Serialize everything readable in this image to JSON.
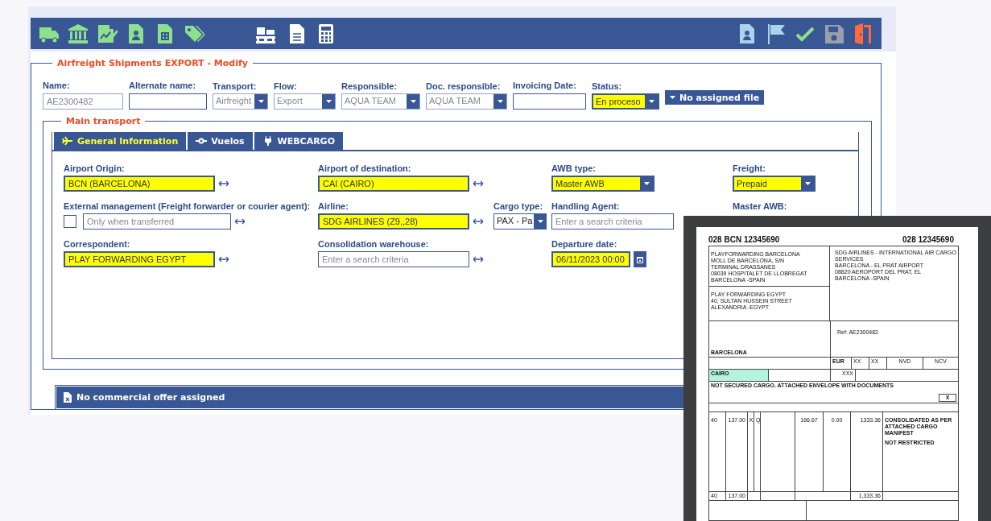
{
  "form": {
    "title": "Airfreight Shipments EXPORT - Modify",
    "header_fields": [
      {
        "kind": "input",
        "label": "Name:",
        "value": "AE2300482",
        "disabled": true,
        "required": false
      },
      {
        "kind": "input",
        "label": "Alternate name:",
        "disabled": false,
        "required": false
      },
      {
        "kind": "select",
        "label": "Transport:",
        "value": "Airfreight",
        "disabled": true,
        "required": false
      },
      {
        "kind": "select",
        "label": "Flow:",
        "value": "Export",
        "disabled": true,
        "required": false
      },
      {
        "kind": "select",
        "label": "Responsible:",
        "value": "AQUA TEAM",
        "disabled": true,
        "required": false
      },
      {
        "kind": "select",
        "label": "Doc. responsible:",
        "value": "AQUA TEAM",
        "disabled": true,
        "required": false
      },
      {
        "kind": "input",
        "label": "Invoicing Date:",
        "disabled": false,
        "required": false
      },
      {
        "kind": "select",
        "label": "Status:",
        "value": "En proceso",
        "disabled": false,
        "required": true
      },
      {
        "kind": "button",
        "text": "No assigned file"
      }
    ],
    "main_transport": {
      "title": "Main transport",
      "tabs": [
        {
          "label": "General Information",
          "selected": true
        },
        {
          "label": "Vuelos",
          "selected": false
        },
        {
          "label": "WEBCARGO",
          "selected": false
        }
      ],
      "rows": [
        {
          "cells": [
            {
              "fields": [
                {
                  "kind": "link_input",
                  "label": "Airport Origin:",
                  "value": "BCN (BARCELONA)",
                  "required": true
                }
              ]
            },
            {
              "fields": [
                {
                  "kind": "link_input",
                  "label": "Airport of destination:",
                  "value": "CAI (CAIRO)",
                  "required": true
                }
              ]
            },
            {
              "fields": [
                {
                  "kind": "select",
                  "label": "AWB type:",
                  "value": "Master AWB",
                  "required": true
                }
              ]
            },
            {
              "fields": [
                {
                  "kind": "select",
                  "label": "Freight:",
                  "value": "Prepaid",
                  "required": true
                }
              ]
            }
          ]
        },
        {
          "cells": [
            {
              "fields": [
                {
                  "kind": "check_input",
                  "label": "External management (Freight forwarder or courier agent):",
                  "placeholder": "Only when transferred",
                  "checked": false,
                  "required": false
                }
              ]
            },
            {
              "fields": [
                {
                  "kind": "link_input",
                  "label": "Airline:",
                  "value": "SDG AIRLINES (Z9,,28)",
                  "required": true
                },
                {
                  "kind": "select",
                  "label": "Cargo type:",
                  "value": "PAX - Pa",
                  "required": false
                }
              ]
            },
            {
              "fields": [
                {
                  "kind": "input",
                  "label": "Handling Agent:",
                  "placeholder": "Enter a search criteria",
                  "required": false
                }
              ]
            },
            {
              "fields": [
                {
                  "kind": "label",
                  "label": "Master AWB:"
                }
              ]
            }
          ]
        },
        {
          "cells": [
            {
              "fields": [
                {
                  "kind": "link_input",
                  "label": "Correspondent:",
                  "value": "PLAY FORWARDING EGYPT",
                  "required": true
                }
              ]
            },
            {
              "fields": [
                {
                  "kind": "link_input",
                  "label": "Consolidation warehouse:",
                  "placeholder": "Enter a search criteria",
                  "required": false
                }
              ]
            },
            {
              "fields": [
                {
                  "kind": "date",
                  "label": "Departure date:",
                  "value": "06/11/2023 00:00",
                  "required": true
                }
              ]
            }
          ]
        }
      ]
    },
    "commercial_offer": "No commercial offer assigned"
  },
  "awb_document": {
    "number_left": "028 BCN  12345690",
    "number_right": "028  12345690",
    "shipper": [
      "PLAYFORWARDING BARCELONA",
      "MOLL DE BARCELONA, S/N",
      "TERMINAL DRASSANES",
      "08039 HOSPITALET DE LLOBREGAT",
      "BARCELONA -SPAIN"
    ],
    "consignee": [
      "PLAY FORWARDING EGYPT",
      "40, SULTAN HUSSEIN STREET",
      "ALEXANDRIA -EGYPT"
    ],
    "carrier": [
      "SDG AIRLINES - INTERNATIONAL AIR CARGO",
      "SERVICES",
      "BARCELONA - EL PRAT AIRPORT",
      "08820 AEROPORT DEL PRAT, EL",
      "BARCELONA -SPAIN"
    ],
    "reference": "Ref: AE2300482",
    "departure": "BARCELONA",
    "currency": "EUR",
    "charge_codes": [
      "XX",
      "XX"
    ],
    "declared_carriage": "NVD",
    "declared_customs": "NCV",
    "destination": "CAIRO",
    "insurance": "XXX",
    "handling_info": "NOT SECURED CARGO. ATTACHED ENVELOPE WITH DOCUMENTS",
    "sci": "X",
    "rate_line": {
      "pieces": "40",
      "gross_weight": "137.00",
      "unit": "K",
      "rate_class": "Q",
      "chargeable_rate": "166.67",
      "charge": "0.00",
      "total": "1333.36",
      "goods": [
        "CONSOLIDATED AS PER ATTACHED CARGO MANIFEST",
        "NOT RESTRICTED"
      ]
    },
    "totals": {
      "pieces": "40",
      "gross_weight": "137.00",
      "total": "1,333.36"
    }
  }
}
